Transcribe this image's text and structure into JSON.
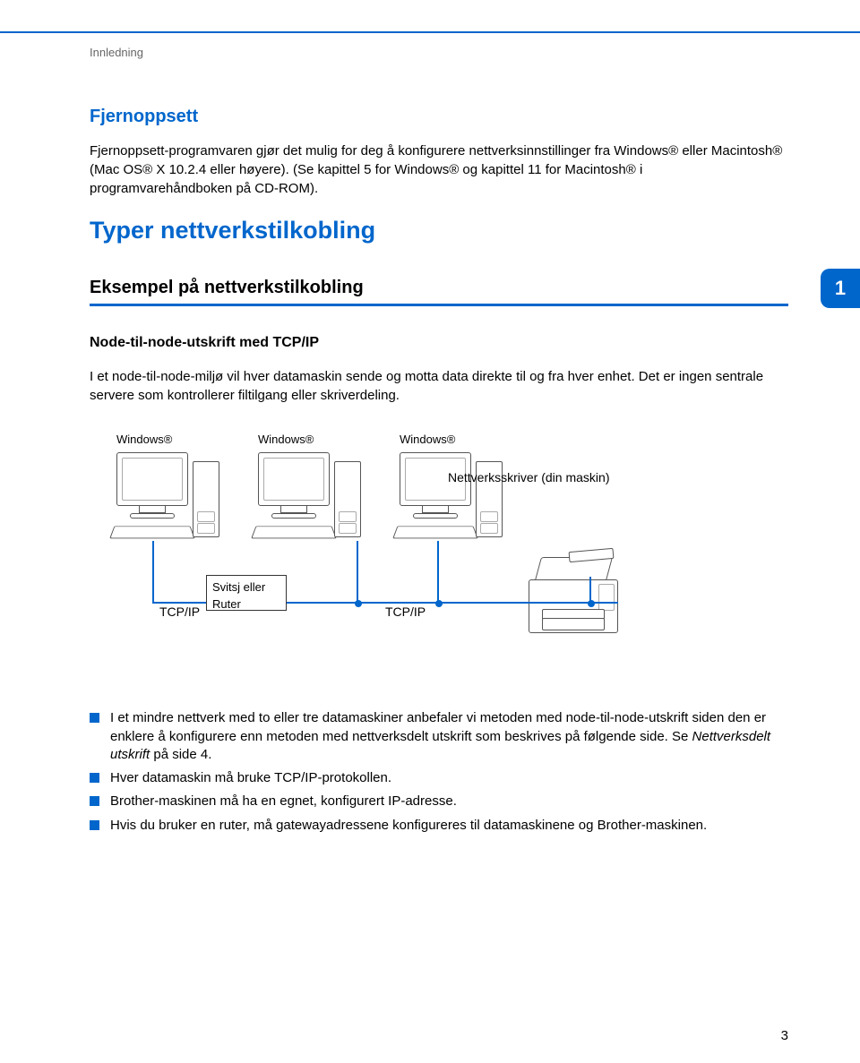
{
  "header_rule": true,
  "section_label": "Innledning",
  "chapter_badge": "1",
  "page_number": "3",
  "h_fjernoppsett": "Fjernoppsett",
  "p_fjernoppsett": "Fjernoppsett-programvaren gjør det mulig for deg å konfigurere nettverksinnstillinger fra Windows® eller Macintosh® (Mac OS® X 10.2.4 eller høyere). (Se kapittel 5 for Windows® og kapittel 11 for Macintosh® i programvarehåndboken på CD-ROM).",
  "h_typer": "Typer nettverkstilkobling",
  "h_eksempel": "Eksempel på nettverkstilkobling",
  "h_node": "Node-til-node-utskrift med TCP/IP",
  "p_node": "I et node-til-node-miljø vil hver datamaskin sende og motta data direkte til og fra hver enhet. Det er ingen sentrale servere som kontrollerer filtilgang eller skriverdeling.",
  "diagram": {
    "pc_label_1": "Windows®",
    "pc_label_2": "Windows®",
    "pc_label_3": "Windows®",
    "printer_label": "Nettverksskriver (din maskin)",
    "router_label": "Svitsj eller Ruter",
    "tcpip_left": "TCP/IP",
    "tcpip_right": "TCP/IP"
  },
  "bullets": [
    {
      "text": "I et mindre nettverk med to eller tre datamaskiner anbefaler vi metoden med node-til-node-utskrift siden den er enklere å konfigurere enn metoden med nettverksdelt utskrift som beskrives på følgende side. Se ",
      "italic": "Nettverksdelt utskrift",
      "after": " på side 4."
    },
    {
      "text": "Hver datamaskin må bruke TCP/IP-protokollen."
    },
    {
      "text": "Brother-maskinen må ha en egnet, konfigurert IP-adresse."
    },
    {
      "text": "Hvis du bruker en ruter, må gatewayadressene konfigureres til datamaskinene og Brother-maskinen."
    }
  ]
}
